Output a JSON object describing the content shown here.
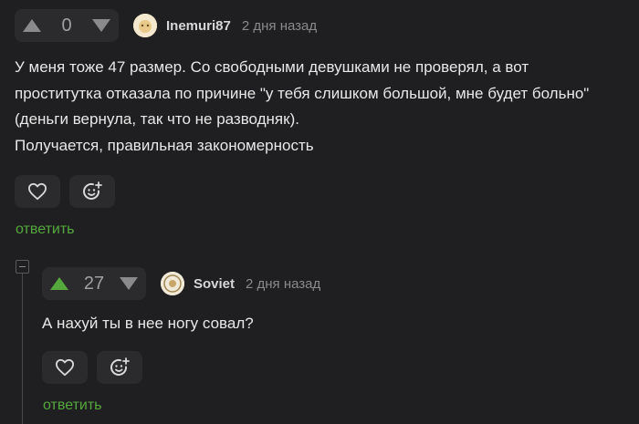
{
  "comments": [
    {
      "rating": "0",
      "username": "Inemuri87",
      "time": "2 дня назад",
      "lines": [
        "У меня тоже 47 размер. Со свободными девушками не проверял, а вот",
        "проститутка отказала по причине \"у тебя слишком большой, мне будет больно\"",
        "(деньги вернула, так что не разводняк).",
        "Получается, правильная закономерность"
      ],
      "reply": "ответить"
    },
    {
      "rating": "27",
      "username": "Soviet",
      "time": "2 дня назад",
      "lines": [
        "А нахуй ты в нее ногу совал?"
      ],
      "reply": "ответить"
    }
  ],
  "colors": {
    "accent": "#55a83c",
    "background": "#1f1f21",
    "button": "#2b2b2d"
  },
  "icons": [
    "arrow-up-icon",
    "arrow-down-icon",
    "heart-icon",
    "emoji-add-icon",
    "collapse-icon"
  ]
}
